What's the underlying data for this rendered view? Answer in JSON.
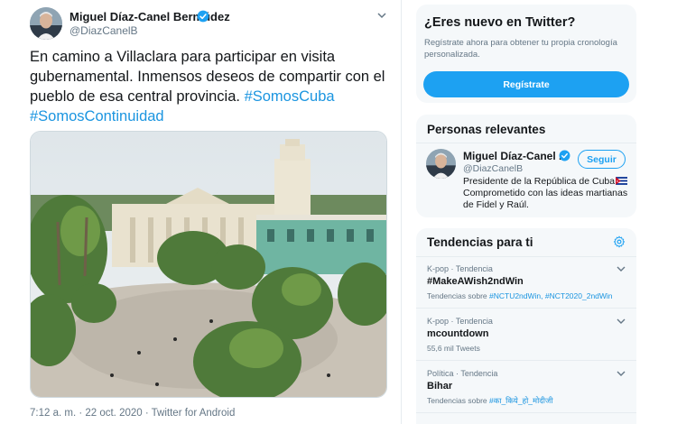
{
  "tweet": {
    "author_name": "Miguel Díaz-Canel Bermúdez",
    "author_handle": "@DiazCanelB",
    "text_lines": [
      "En camino a Villaclara para participar en visita",
      "gubernamental. Inmensos deseos de compartir con el",
      "pueblo de esa central provincia. "
    ],
    "hashtag_1": "#SomosCuba",
    "hashtag_2": "#SomosContinuidad",
    "meta": "7:12 a. m. · 22 oct. 2020 · Twitter for Android"
  },
  "signup": {
    "title": "¿Eres nuevo en Twitter?",
    "description": "Regístrate ahora para obtener tu propia cronología personalizada.",
    "button_label": "Regístrate"
  },
  "people": {
    "title": "Personas relevantes",
    "name": "Miguel Díaz-Canel ...",
    "handle": "@DiazCanelB",
    "follow_label": "Seguir",
    "bio_lines": [
      "Presidente de la República de Cuba",
      "Comprometido con las ideas martianas",
      "de Fidel y Raúl."
    ]
  },
  "trends": {
    "title": "Tendencias para ti",
    "items": [
      {
        "meta": "K-pop · Tendencia",
        "name": "#MakeAWish2ndWin",
        "sub_prefix": "Tendencias sobre ",
        "sub_tags": "#NCTU2ndWin, #NCT2020_2ndWin"
      },
      {
        "meta": "K-pop · Tendencia",
        "name": "mcountdown",
        "sub_prefix": "55,6 mil Tweets",
        "sub_tags": ""
      },
      {
        "meta": "Política · Tendencia",
        "name": "Bihar",
        "sub_prefix": "Tendencias sobre ",
        "sub_tags": "#का_किये_हो_मोदीजी"
      }
    ]
  },
  "colors": {
    "accent": "#1da1f2",
    "link": "#1b95e0",
    "muted": "#657786",
    "card_bg": "#f5f8fa"
  },
  "icons": [
    "verified-icon",
    "chevron-down-icon",
    "settings-gear-icon",
    "cuba-flag-icon"
  ]
}
